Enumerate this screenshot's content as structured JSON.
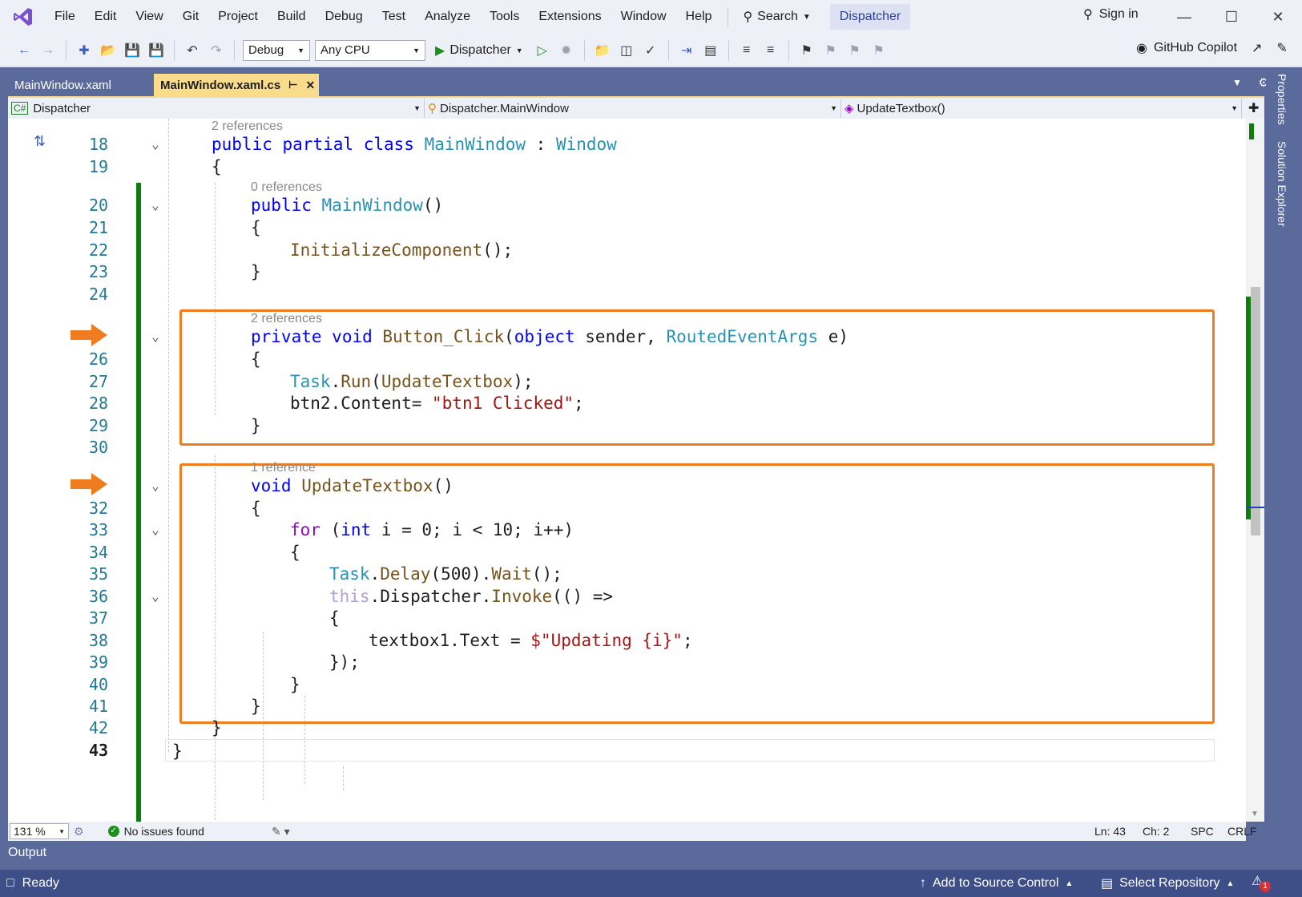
{
  "menu": {
    "items": [
      "File",
      "Edit",
      "View",
      "Git",
      "Project",
      "Build",
      "Debug",
      "Test",
      "Analyze",
      "Tools",
      "Extensions",
      "Window",
      "Help"
    ],
    "search_label": "Search",
    "solution_name": "Dispatcher",
    "sign_in_label": "Sign in"
  },
  "toolbar": {
    "configuration": "Debug",
    "platform": "Any CPU",
    "run_target": "Dispatcher",
    "copilot_label": "GitHub Copilot"
  },
  "tabs": [
    {
      "label": "MainWindow.xaml",
      "active": false
    },
    {
      "label": "MainWindow.xaml.cs",
      "active": true
    }
  ],
  "navbar": {
    "project": "Dispatcher",
    "type": "Dispatcher.MainWindow",
    "member": "UpdateTextbox()"
  },
  "side_panels": [
    "Properties",
    "Solution Explorer"
  ],
  "code": {
    "ref_hints": {
      "class": "2 references",
      "ctor": "0 references",
      "button_click": "2 references",
      "update": "1 reference"
    },
    "line_numbers": {
      "l18": "18",
      "l19": "19",
      "l20": "20",
      "l21": "21",
      "l22": "22",
      "l23": "23",
      "l24": "24",
      "l26": "26",
      "l27": "27",
      "l28": "28",
      "l29": "29",
      "l30": "30",
      "l32": "32",
      "l33": "33",
      "l34": "34",
      "l35": "35",
      "l36": "36",
      "l37": "37",
      "l38": "38",
      "l39": "39",
      "l40": "40",
      "l41": "41",
      "l42": "42",
      "l43": "43"
    },
    "tokens": {
      "public": "public",
      "partial": "partial",
      "class": "class",
      "MainWindow": "MainWindow",
      "colon": ":",
      "Window": "Window",
      "open_brace": "{",
      "close_brace": "}",
      "ctor_parens": "()",
      "InitializeComponent": "InitializeComponent",
      "call_end": "();",
      "private": "private",
      "void": "void",
      "Button_Click": "Button_Click",
      "lparen": "(",
      "object": "object",
      "sender": " sender, ",
      "RoutedEventArgs": "RoutedEventArgs",
      "e_param": " e)",
      "Task": "Task",
      "dot": ".",
      "Run": "Run",
      "UpdateTextbox": "UpdateTextbox",
      "run_end": ");",
      "btn2_content": "btn2.Content= ",
      "btn1_clicked": "\"btn1 Clicked\"",
      "semicolon": ";",
      "for": "for",
      "for_open": " (",
      "int": "int",
      "for_rest": " i = 0; i < 10; i++)",
      "Delay": "Delay",
      "delay_arg": "(500).",
      "Wait": "Wait",
      "this": "this",
      "dispatcher": ".Dispatcher.",
      "Invoke": "Invoke",
      "invoke_rest": "(() =>",
      "textbox_assign": "textbox1.Text = ",
      "interp_string": "$\"Updating {i}\"",
      "close_lambda": "});"
    }
  },
  "editor_status": {
    "zoom": "131 %",
    "issues": "No issues found",
    "line": "Ln: 43",
    "col": "Ch: 2",
    "whitespace": "SPC",
    "line_ending": "CRLF"
  },
  "output_label": "Output",
  "statusbar": {
    "ready": "Ready",
    "add_source_control": "Add to Source Control",
    "select_repository": "Select Repository",
    "notification_count": "1"
  },
  "colors": {
    "accent": "#3d4f86",
    "highlight_box": "#f07c20",
    "change_bar": "#107c10",
    "active_tab": "#f9dc8b"
  }
}
